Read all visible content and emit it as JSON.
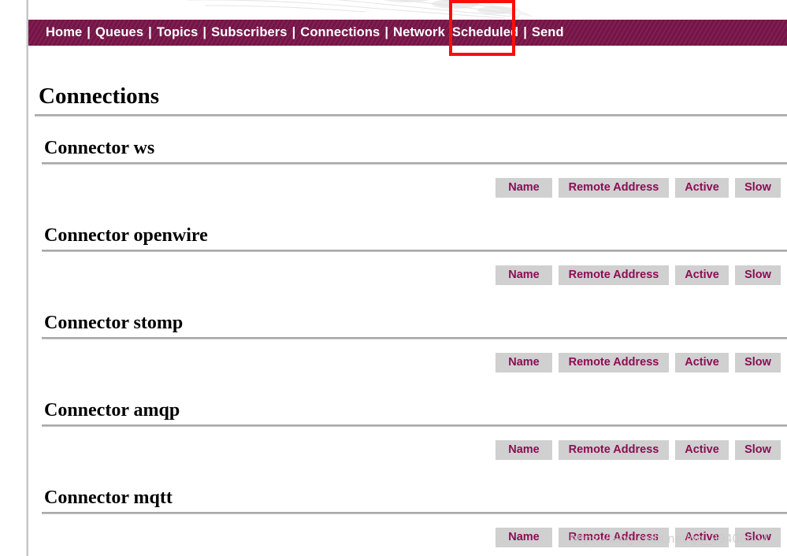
{
  "nav": {
    "separator": "|",
    "items": [
      {
        "label": "Home",
        "name": "nav-home"
      },
      {
        "label": "Queues",
        "name": "nav-queues"
      },
      {
        "label": "Topics",
        "name": "nav-topics"
      },
      {
        "label": "Subscribers",
        "name": "nav-subscribers"
      },
      {
        "label": "Connections",
        "name": "nav-connections"
      },
      {
        "label": "Network",
        "name": "nav-network"
      },
      {
        "label": "Scheduled",
        "name": "nav-scheduled"
      },
      {
        "label": "Send",
        "name": "nav-send"
      }
    ],
    "highlighted_item": "Network"
  },
  "page": {
    "title": "Connections"
  },
  "table": {
    "columns": [
      "Name",
      "Remote Address",
      "Active",
      "Slow"
    ],
    "rows": []
  },
  "sections": [
    {
      "title": "Connector ws"
    },
    {
      "title": "Connector openwire"
    },
    {
      "title": "Connector stomp"
    },
    {
      "title": "Connector amqp"
    },
    {
      "title": "Connector mqtt"
    }
  ],
  "watermark": {
    "text": "https://blog.csdn.net/qq_39406607"
  },
  "colors": {
    "nav_background": "#751446",
    "nav_text": "#ffffff",
    "annotation": "#fb0d0d",
    "table_header_background": "#d0d0d0",
    "table_header_text": "#8c0d54",
    "rule": "#a8a8a8"
  }
}
